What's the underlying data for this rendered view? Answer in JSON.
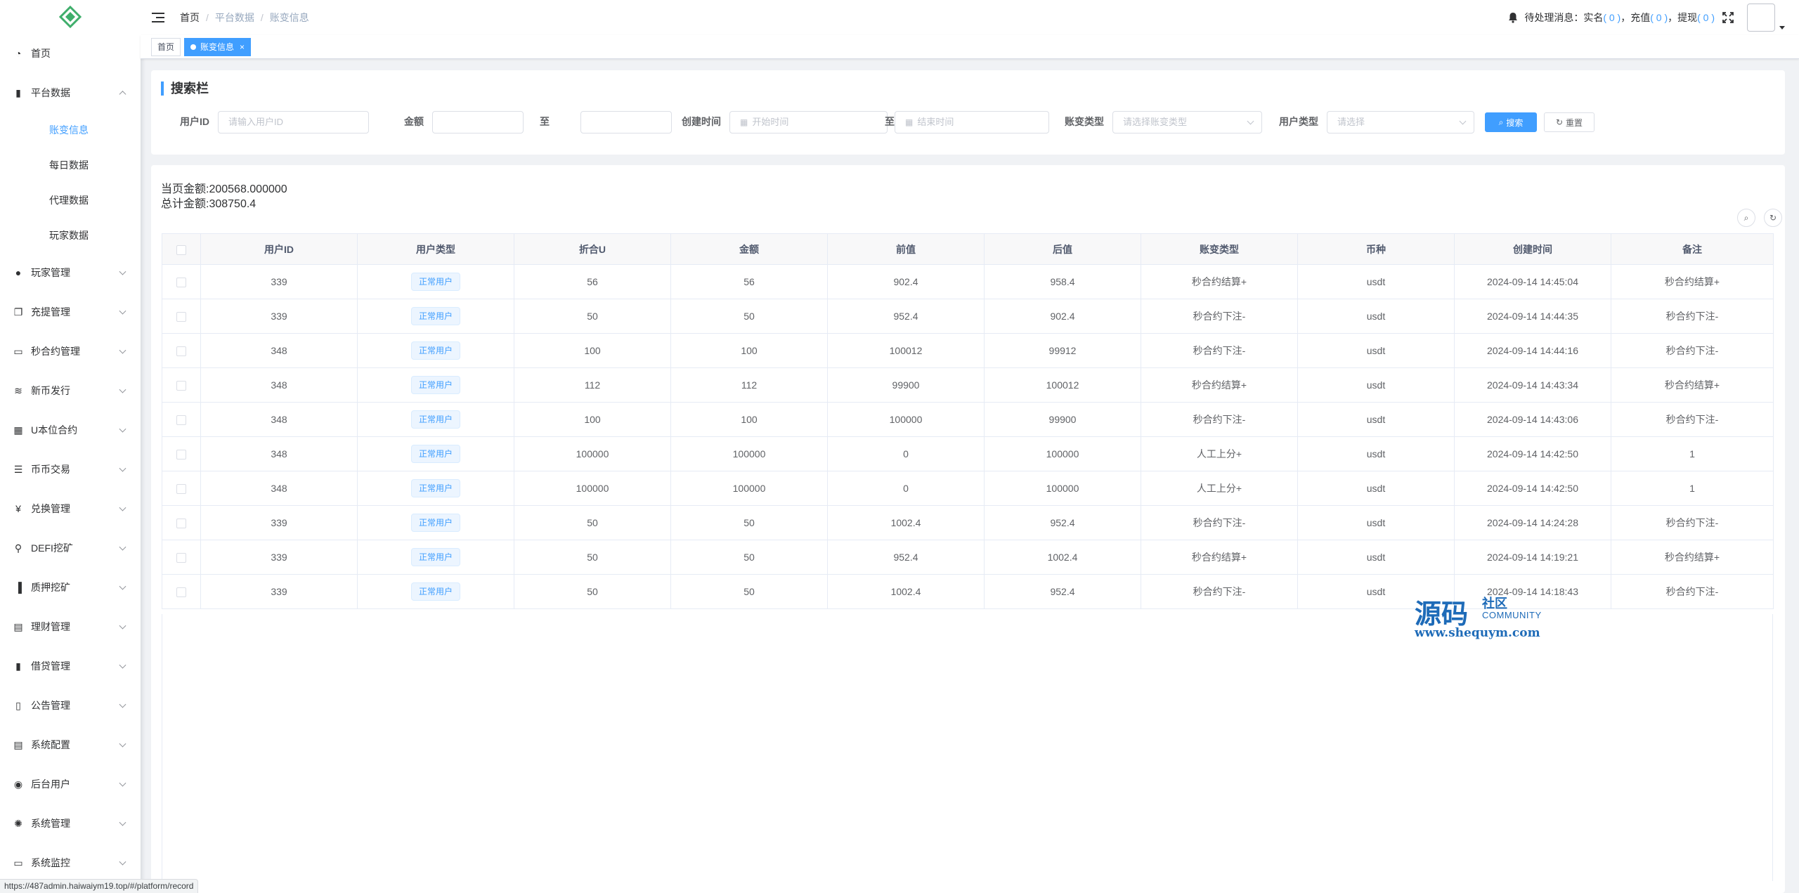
{
  "sidebar": {
    "items": [
      {
        "label": "首页",
        "icon": "dashboard-icon",
        "expandable": false
      },
      {
        "label": "平台数据",
        "icon": "book-icon",
        "expandable": true,
        "expanded": true,
        "children": [
          {
            "label": "账变信息",
            "active": true
          },
          {
            "label": "每日数据",
            "active": false
          },
          {
            "label": "代理数据",
            "active": false
          },
          {
            "label": "玩家数据",
            "active": false
          }
        ]
      },
      {
        "label": "玩家管理",
        "icon": "user-icon",
        "expandable": true
      },
      {
        "label": "充提管理",
        "icon": "copy-icon",
        "expandable": true
      },
      {
        "label": "秒合约管理",
        "icon": "monitor-icon",
        "expandable": true
      },
      {
        "label": "新币发行",
        "icon": "chart-icon",
        "expandable": true
      },
      {
        "label": "U本位合约",
        "icon": "grid-icon",
        "expandable": true
      },
      {
        "label": "币币交易",
        "icon": "list-icon",
        "expandable": true
      },
      {
        "label": "兑换管理",
        "icon": "yen-icon",
        "expandable": true
      },
      {
        "label": "DEFI挖矿",
        "icon": "person-walk-icon",
        "expandable": true
      },
      {
        "label": "质押挖矿",
        "icon": "bar-chart-icon",
        "expandable": true
      },
      {
        "label": "理财管理",
        "icon": "document-icon",
        "expandable": true
      },
      {
        "label": "借贷管理",
        "icon": "book-icon",
        "expandable": true
      },
      {
        "label": "公告管理",
        "icon": "open-book-icon",
        "expandable": true
      },
      {
        "label": "系统配置",
        "icon": "document-icon",
        "expandable": true
      },
      {
        "label": "后台用户",
        "icon": "users-icon",
        "expandable": true
      },
      {
        "label": "系统管理",
        "icon": "gear-icon",
        "expandable": true
      },
      {
        "label": "系统监控",
        "icon": "monitor-icon",
        "expandable": true
      }
    ]
  },
  "navbar": {
    "breadcrumb": [
      "首页",
      "平台数据",
      "账变信息"
    ],
    "pending_label": "待处理消息：实名",
    "realname_count": "( 0 )",
    "recharge_label": "，充值",
    "recharge_count": "( 0 )",
    "withdraw_label": "，提现",
    "withdraw_count": "( 0 )"
  },
  "tags": [
    {
      "label": "首页",
      "active": false
    },
    {
      "label": "账变信息",
      "active": true,
      "close": "×"
    }
  ],
  "search": {
    "title": "搜索栏",
    "user_id_label": "用户ID",
    "user_id_placeholder": "请输入用户ID",
    "amount_label": "金额",
    "to_label": "至",
    "created_label": "创建时间",
    "start_placeholder": "开始时间",
    "date_to_label": "至",
    "end_placeholder": "结束时间",
    "change_type_label": "账变类型",
    "change_type_placeholder": "请选择账变类型",
    "user_type_label": "用户类型",
    "user_type_placeholder": "请选择",
    "search_btn": "搜索",
    "reset_btn": "重置"
  },
  "summary": {
    "page_amount": "当页金额:200568.000000",
    "total_amount": "总计金额:308750.4"
  },
  "table": {
    "headers": [
      "用户ID",
      "用户类型",
      "折合U",
      "金额",
      "前值",
      "后值",
      "账变类型",
      "币种",
      "创建时间",
      "备注"
    ],
    "rows": [
      [
        "339",
        "正常用户",
        "56",
        "56",
        "902.4",
        "958.4",
        "秒合约结算+",
        "usdt",
        "2024-09-14 14:45:04",
        "秒合约结算+"
      ],
      [
        "339",
        "正常用户",
        "50",
        "50",
        "952.4",
        "902.4",
        "秒合约下注-",
        "usdt",
        "2024-09-14 14:44:35",
        "秒合约下注-"
      ],
      [
        "348",
        "正常用户",
        "100",
        "100",
        "100012",
        "99912",
        "秒合约下注-",
        "usdt",
        "2024-09-14 14:44:16",
        "秒合约下注-"
      ],
      [
        "348",
        "正常用户",
        "112",
        "112",
        "99900",
        "100012",
        "秒合约结算+",
        "usdt",
        "2024-09-14 14:43:34",
        "秒合约结算+"
      ],
      [
        "348",
        "正常用户",
        "100",
        "100",
        "100000",
        "99900",
        "秒合约下注-",
        "usdt",
        "2024-09-14 14:43:06",
        "秒合约下注-"
      ],
      [
        "348",
        "正常用户",
        "100000",
        "100000",
        "0",
        "100000",
        "人工上分+",
        "usdt",
        "2024-09-14 14:42:50",
        "1"
      ],
      [
        "348",
        "正常用户",
        "100000",
        "100000",
        "0",
        "100000",
        "人工上分+",
        "usdt",
        "2024-09-14 14:42:50",
        "1"
      ],
      [
        "339",
        "正常用户",
        "50",
        "50",
        "1002.4",
        "952.4",
        "秒合约下注-",
        "usdt",
        "2024-09-14 14:24:28",
        "秒合约下注-"
      ],
      [
        "339",
        "正常用户",
        "50",
        "50",
        "952.4",
        "1002.4",
        "秒合约结算+",
        "usdt",
        "2024-09-14 14:19:21",
        "秒合约结算+"
      ],
      [
        "339",
        "正常用户",
        "50",
        "50",
        "1002.4",
        "952.4",
        "秒合约下注-",
        "usdt",
        "2024-09-14 14:18:43",
        "秒合约下注-"
      ]
    ]
  },
  "watermark": {
    "big": "源码",
    "small": "社区",
    "community": "COMMUNITY",
    "url": "www.shequym.com"
  },
  "statusbar": {
    "url": "https://487admin.haiwaiym19.top/#/platform/record"
  },
  "colors": {
    "primary": "#409eff",
    "sidebar_bg": "#ffffff",
    "page_bg": "#f0f2f5",
    "watermark": "#1e6bb8"
  }
}
